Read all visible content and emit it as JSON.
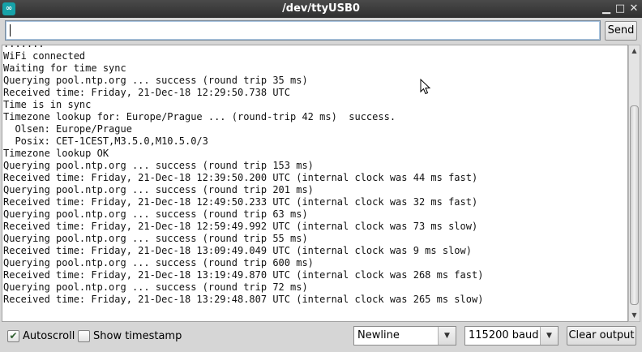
{
  "window": {
    "title": "/dev/ttyUSB0",
    "app_icon": "arduino-logo-icon",
    "controls": [
      "minimize-icon",
      "maximize-icon",
      "close-icon"
    ]
  },
  "send_row": {
    "input_value": "",
    "send_label": "Send"
  },
  "output_lines": [
    ".......",
    "WiFi connected",
    "Waiting for time sync",
    "Querying pool.ntp.org ... success (round trip 35 ms)",
    "Received time: Friday, 21-Dec-18 12:29:50.738 UTC",
    "Time is in sync",
    "Timezone lookup for: Europe/Prague ... (round-trip 42 ms)  success.",
    "  Olsen: Europe/Prague",
    "  Posix: CET-1CEST,M3.5.0,M10.5.0/3",
    "Timezone lookup OK",
    "Querying pool.ntp.org ... success (round trip 153 ms)",
    "Received time: Friday, 21-Dec-18 12:39:50.200 UTC (internal clock was 44 ms fast)",
    "Querying pool.ntp.org ... success (round trip 201 ms)",
    "Received time: Friday, 21-Dec-18 12:49:50.233 UTC (internal clock was 32 ms fast)",
    "Querying pool.ntp.org ... success (round trip 63 ms)",
    "Received time: Friday, 21-Dec-18 12:59:49.992 UTC (internal clock was 73 ms slow)",
    "Querying pool.ntp.org ... success (round trip 55 ms)",
    "Received time: Friday, 21-Dec-18 13:09:49.049 UTC (internal clock was 9 ms slow)",
    "Querying pool.ntp.org ... success (round trip 600 ms)",
    "Received time: Friday, 21-Dec-18 13:19:49.870 UTC (internal clock was 268 ms fast)",
    "Querying pool.ntp.org ... success (round trip 72 ms)",
    "Received time: Friday, 21-Dec-18 13:29:48.807 UTC (internal clock was 265 ms slow)"
  ],
  "bottom_bar": {
    "autoscroll_label": "Autoscroll",
    "autoscroll_checked": true,
    "timestamp_label": "Show timestamp",
    "timestamp_checked": false,
    "line_ending": "Newline",
    "baud_rate": "115200 baud",
    "clear_label": "Clear output"
  }
}
